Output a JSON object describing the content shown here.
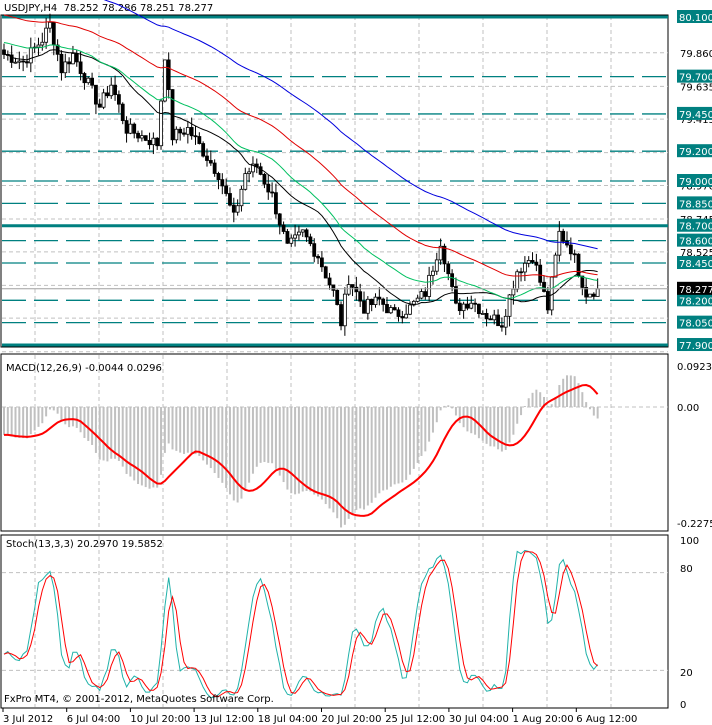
{
  "header": {
    "symbol": "USDJPY,H4",
    "open": "78.252",
    "high": "78.286",
    "low": "78.251",
    "close": "78.277"
  },
  "copyright": "FxPro MT4, © 2001-2012, MetaQuotes Software Corp.",
  "price_axis": {
    "labels": [
      "79.860",
      "79.635",
      "79.415",
      "78.970",
      "78.745",
      "78.525"
    ],
    "current": "78.277"
  },
  "levels": {
    "solid": [
      "80.100",
      "78.700",
      "77.900"
    ],
    "dashed": [
      "79.700",
      "79.450",
      "79.200",
      "79.000",
      "78.850",
      "78.600",
      "78.450",
      "78.200",
      "78.050"
    ],
    "color": "#008080"
  },
  "time_axis": [
    "3 Jul 2012",
    "6 Jul 04:00",
    "10 Jul 20:00",
    "13 Jul 12:00",
    "18 Jul 04:00",
    "20 Jul 20:00",
    "25 Jul 12:00",
    "30 Jul 04:00",
    "1 Aug 20:00",
    "6 Aug 12:00"
  ],
  "macd": {
    "label": "MACD(12,26,9) -0.0044 0.0296",
    "axis": [
      "0.0923",
      "0.00",
      "-0.2275"
    ]
  },
  "stoch": {
    "label": "Stoch(13,3,3) 20.2970 19.5852",
    "axis": [
      "100",
      "80",
      "20",
      "0"
    ]
  },
  "chart_data": {
    "type": "candlestick",
    "title": "USDJPY,H4",
    "ylim": [
      77.855,
      80.1
    ],
    "close_keypoints": [
      [
        0,
        79.85
      ],
      [
        5,
        79.8
      ],
      [
        10,
        79.95
      ],
      [
        12,
        80.05
      ],
      [
        15,
        79.75
      ],
      [
        18,
        79.85
      ],
      [
        22,
        79.65
      ],
      [
        25,
        79.5
      ],
      [
        28,
        79.65
      ],
      [
        32,
        79.35
      ],
      [
        36,
        79.3
      ],
      [
        40,
        79.25
      ],
      [
        42,
        79.85
      ],
      [
        44,
        79.3
      ],
      [
        48,
        79.35
      ],
      [
        52,
        79.2
      ],
      [
        56,
        79.05
      ],
      [
        60,
        78.75
      ],
      [
        63,
        79.05
      ],
      [
        66,
        79.1
      ],
      [
        70,
        78.9
      ],
      [
        74,
        78.55
      ],
      [
        78,
        78.65
      ],
      [
        82,
        78.5
      ],
      [
        86,
        78.25
      ],
      [
        88,
        78.05
      ],
      [
        90,
        78.35
      ],
      [
        94,
        78.15
      ],
      [
        98,
        78.2
      ],
      [
        102,
        78.1
      ],
      [
        106,
        78.15
      ],
      [
        110,
        78.25
      ],
      [
        114,
        78.6
      ],
      [
        118,
        78.15
      ],
      [
        122,
        78.2
      ],
      [
        126,
        78.1
      ],
      [
        130,
        78.05
      ],
      [
        134,
        78.4
      ],
      [
        138,
        78.5
      ],
      [
        142,
        78.15
      ],
      [
        145,
        78.65
      ],
      [
        148,
        78.55
      ],
      [
        152,
        78.25
      ],
      [
        155,
        78.277
      ]
    ],
    "ma_colors": [
      "#000000",
      "#00c060",
      "#e00000",
      "#0000dd"
    ]
  }
}
